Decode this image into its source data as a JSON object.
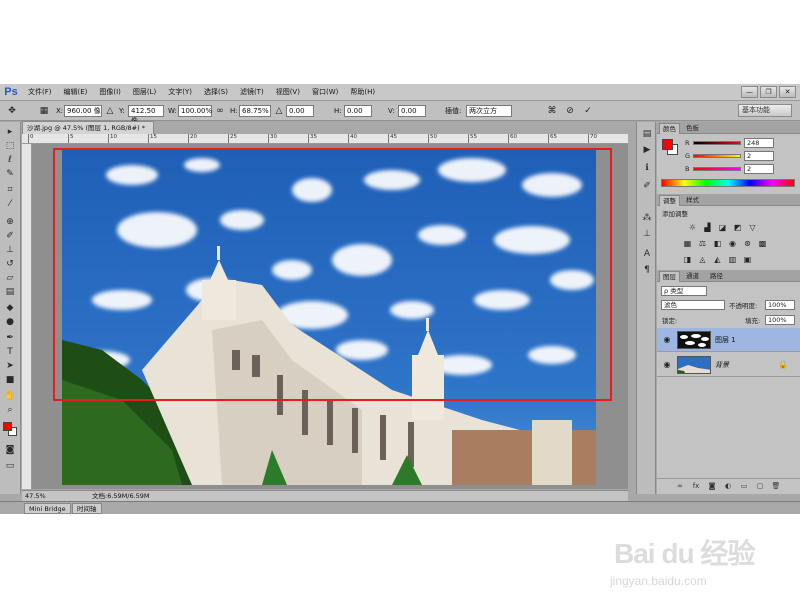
{
  "menubar": {
    "logo": "Ps",
    "items": [
      "文件(F)",
      "编辑(E)",
      "图像(I)",
      "图层(L)",
      "文字(Y)",
      "选择(S)",
      "滤镜(T)",
      "视图(V)",
      "窗口(W)",
      "帮助(H)"
    ],
    "window_controls": [
      "—",
      "❐",
      "✕"
    ]
  },
  "options": {
    "x_label": "X:",
    "x_value": "960.00 像",
    "y_label": "Y:",
    "y_value": "412.50 像",
    "w_label": "W:",
    "w_value": "100.00%",
    "h_label": "H:",
    "h_value": "68.75%",
    "angle_value": "0.00",
    "hskew_label": "H:",
    "hskew_value": "0.00",
    "vskew_label": "V:",
    "vskew_value": "0.00",
    "interp_label": "插值:",
    "interp_value": "两次立方",
    "workspace": "基本功能"
  },
  "document": {
    "tab_title": "沙湖.jpg @ 47.5% (图层 1, RGB/8#) *",
    "zoom": "47.5%",
    "doc_size": "文档:6.59M/6.59M"
  },
  "ruler": {
    "ticks": [
      "0",
      "5",
      "10",
      "15",
      "20",
      "25",
      "30",
      "35",
      "40",
      "45",
      "50",
      "55",
      "60",
      "65",
      "70"
    ]
  },
  "bottom_tabs": [
    "Mini Bridge",
    "时间轴"
  ],
  "color_panel": {
    "tabs": [
      "颜色",
      "色板"
    ],
    "r_label": "R",
    "r_value": "248",
    "g_label": "G",
    "g_value": "2",
    "b_label": "B",
    "b_value": "2",
    "foreground_color": "#f80202"
  },
  "adjustments_panel": {
    "tabs": [
      "调整",
      "样式"
    ],
    "title": "添加调整"
  },
  "layers_panel": {
    "tabs": [
      "图层",
      "通道",
      "路径"
    ],
    "filter_label": "ρ 类型",
    "blend_mode": "滤色",
    "opacity_label": "不透明度:",
    "opacity_value": "100%",
    "lock_label": "锁定:",
    "fill_label": "填充:",
    "fill_value": "100%",
    "layers": [
      {
        "name": "图层 1",
        "selected": true
      },
      {
        "name": "背景",
        "selected": false
      }
    ]
  },
  "watermark": {
    "main": "Bai du 经验",
    "sub": "jingyan.baidu.com"
  },
  "icons": [
    "move-icon",
    "marquee-icon",
    "lasso-icon",
    "quick-select-icon",
    "crop-icon",
    "eyedropper-icon",
    "healing-icon",
    "brush-icon",
    "stamp-icon",
    "history-brush-icon",
    "eraser-icon",
    "gradient-icon",
    "blur-icon",
    "dodge-icon",
    "pen-icon",
    "type-icon",
    "path-select-icon",
    "shape-icon",
    "hand-icon",
    "zoom-icon",
    "cancel-icon",
    "commit-icon",
    "eye-icon",
    "lock-icon"
  ]
}
